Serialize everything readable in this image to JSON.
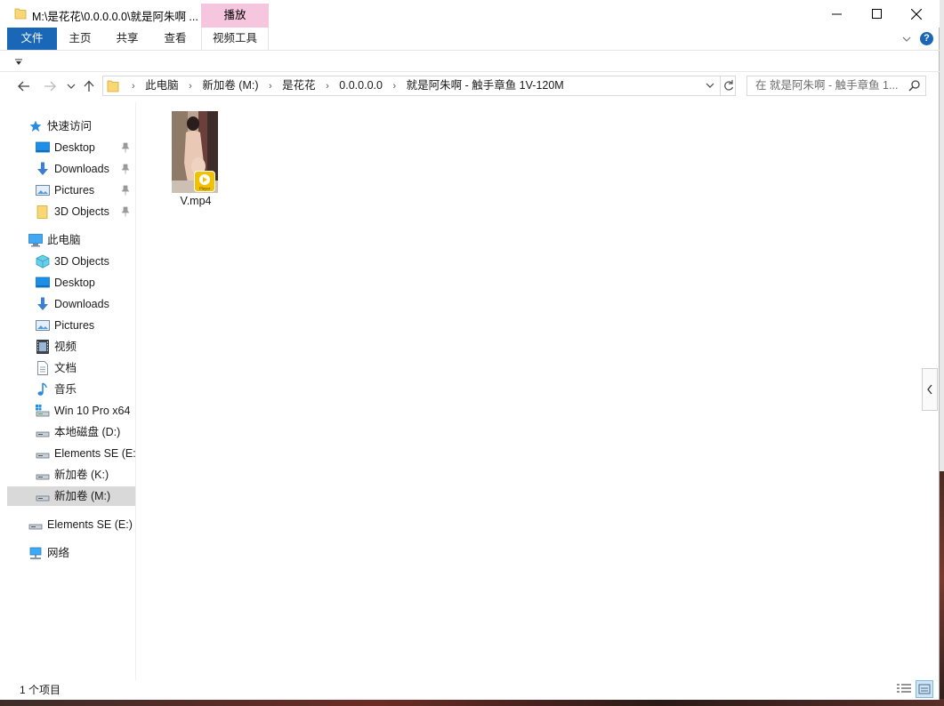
{
  "window": {
    "title": "M:\\是花花\\0.0.0.0.0\\就是阿朱啊 ...",
    "context_tab_header": "播放"
  },
  "ribbon": {
    "tabs": [
      {
        "label": "文件",
        "active": true
      },
      {
        "label": "主页"
      },
      {
        "label": "共享"
      },
      {
        "label": "查看"
      },
      {
        "label": "视频工具"
      }
    ]
  },
  "address": {
    "breadcrumbs": [
      "此电脑",
      "新加卷 (M:)",
      "是花花",
      "0.0.0.0.0",
      "就是阿朱啊 - 触手章鱼  1V-120M"
    ]
  },
  "search": {
    "placeholder": "在 就是阿朱啊 - 触手章鱼   1..."
  },
  "nav": {
    "quick_access": {
      "label": "快速访问",
      "items": [
        {
          "label": "Desktop",
          "icon": "desktop-icon",
          "pinned": true
        },
        {
          "label": "Downloads",
          "icon": "download-icon",
          "pinned": true
        },
        {
          "label": "Pictures",
          "icon": "pictures-icon",
          "pinned": true
        },
        {
          "label": "3D Objects",
          "icon": "folder-icon",
          "pinned": true
        }
      ]
    },
    "this_pc": {
      "label": "此电脑",
      "items": [
        {
          "label": "3D Objects",
          "icon": "3d-objects-icon"
        },
        {
          "label": "Desktop",
          "icon": "desktop-icon"
        },
        {
          "label": "Downloads",
          "icon": "download-icon"
        },
        {
          "label": "Pictures",
          "icon": "pictures-icon"
        },
        {
          "label": "视频",
          "icon": "video-icon"
        },
        {
          "label": "文档",
          "icon": "document-icon"
        },
        {
          "label": "音乐",
          "icon": "music-icon"
        },
        {
          "label": "Win 10 Pro x64",
          "icon": "system-drive-icon"
        },
        {
          "label": "本地磁盘 (D:)",
          "icon": "drive-icon"
        },
        {
          "label": "Elements SE (E:",
          "icon": "drive-icon"
        },
        {
          "label": "新加卷 (K:)",
          "icon": "drive-icon"
        },
        {
          "label": "新加卷 (M:)",
          "icon": "drive-icon",
          "selected": true
        }
      ]
    },
    "external": {
      "label": "Elements SE (E:)",
      "icon": "drive-icon"
    },
    "network": {
      "label": "网络",
      "icon": "network-icon"
    }
  },
  "files": [
    {
      "name": "V.mp4",
      "badge": "Player"
    }
  ],
  "status": {
    "item_count": "1 个项目"
  },
  "colors": {
    "accent": "#1a67b8",
    "context_tab": "#f6c6de",
    "selection": "#d9d9d9"
  }
}
